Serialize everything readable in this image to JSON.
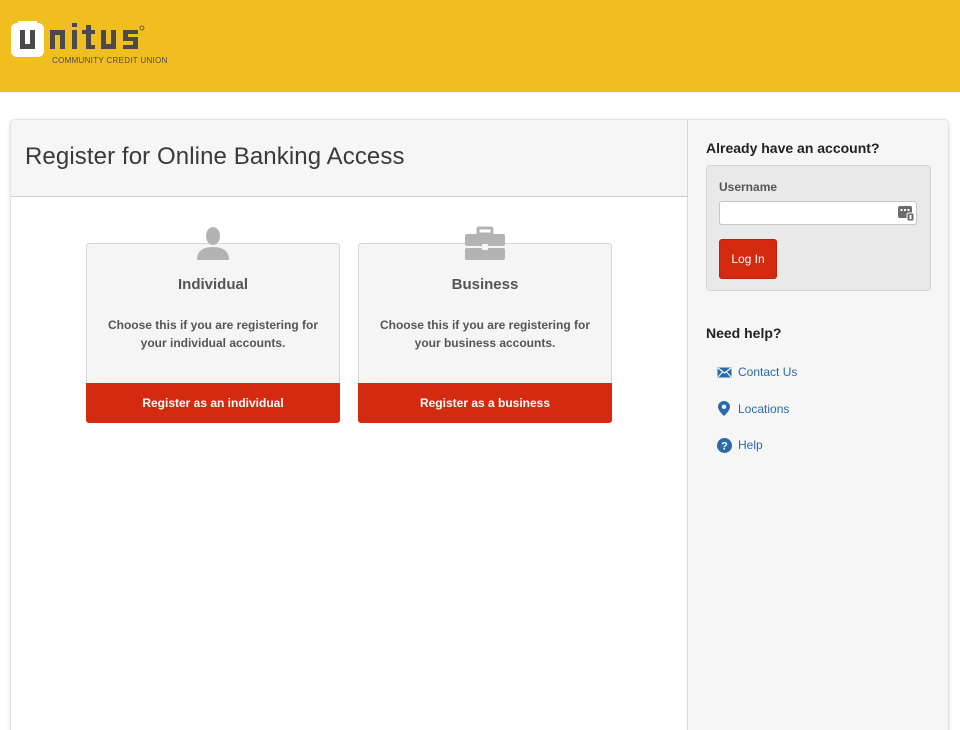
{
  "brand": {
    "name": "unitus",
    "tagline": "COMMUNITY CREDIT UNION",
    "colors": {
      "header": "#f0be1f",
      "accent": "#d42a0f",
      "link": "#2a6aa8"
    }
  },
  "main": {
    "title": "Register for Online Banking Access",
    "cards": [
      {
        "icon": "person-icon",
        "title": "Individual",
        "description": "Choose this if you are registering for your individual accounts.",
        "button_label": "Register as an individual"
      },
      {
        "icon": "briefcase-icon",
        "title": "Business",
        "description": "Choose this if you are registering for your business accounts.",
        "button_label": "Register as a business"
      }
    ]
  },
  "sidebar": {
    "login": {
      "heading": "Already have an account?",
      "username_label": "Username",
      "username_value": "",
      "keypad_icon": "keypad-icon",
      "login_label": "Log In"
    },
    "help": {
      "heading": "Need help?",
      "links": [
        {
          "label": "Contact Us",
          "icon": "envelope-icon"
        },
        {
          "label": "Locations",
          "icon": "map-pin-icon"
        },
        {
          "label": "Help",
          "icon": "question-circle-icon"
        }
      ]
    }
  }
}
